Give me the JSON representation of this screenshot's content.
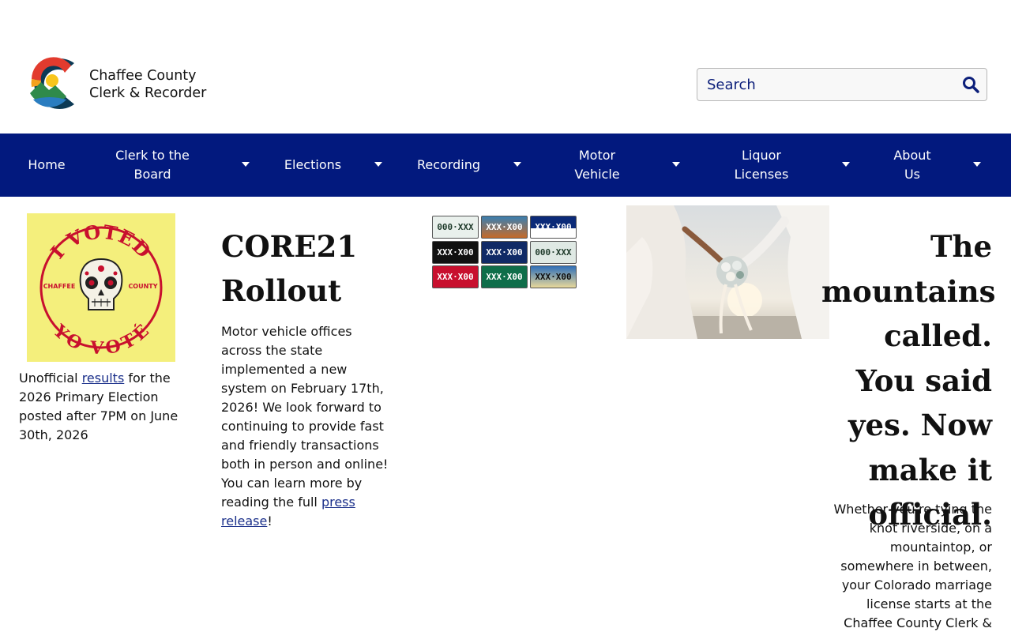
{
  "header": {
    "logo_line1": "Chaffee County",
    "logo_line2": "Clerk & Recorder",
    "logo_icon": "colorado-c-mountain-logo",
    "search_placeholder": "Search",
    "search_icon": "search-icon"
  },
  "nav": {
    "items": [
      {
        "label": "Home",
        "has_dropdown": false
      },
      {
        "label": "Clerk to the Board",
        "has_dropdown": true
      },
      {
        "label": "Elections",
        "has_dropdown": true
      },
      {
        "label": "Recording",
        "has_dropdown": true
      },
      {
        "label": "Motor Vehicle",
        "has_dropdown": true
      },
      {
        "label": "Liquor Licenses",
        "has_dropdown": true
      },
      {
        "label": "About Us",
        "has_dropdown": true
      }
    ]
  },
  "election": {
    "badge_top": "I VOTED",
    "badge_bottom": "YO VOTÉ",
    "badge_left": "CHAFFEE",
    "badge_right": "COUNTY",
    "text_before": "Unofficial ",
    "link": "results",
    "text_after": " for the 2026 Primary Election posted after 7PM on June 30th, 2026"
  },
  "core21": {
    "title": "CORE21 Rollout",
    "body": "Motor vehicle offices across the state implemented a new system on February 17th, 2026! We look forward to continuing to provide fast and friendly transactions both in person and online! You can learn more by reading the full ",
    "link": "press release",
    "end": "!"
  },
  "plates": [
    {
      "text": "000·XXX"
    },
    {
      "text": "XXX·X00"
    },
    {
      "text": "XXX·X00"
    },
    {
      "text": "XXX·X00"
    },
    {
      "text": "XXX·X00"
    },
    {
      "text": "000·XXX"
    },
    {
      "text": "XXX·X00"
    },
    {
      "text": "XXX·X00"
    },
    {
      "text": "XXX·X00"
    }
  ],
  "marriage": {
    "title": "The mountains called. You said yes. Now make it official.",
    "body": "Whether you're tying the knot riverside, on a mountaintop, or somewhere in between, your Colorado marriage license starts at the Chaffee County Clerk &"
  },
  "colors": {
    "nav_bg": "#02197e",
    "link": "#1a2f8a",
    "badge_bg": "#f4ef7c",
    "badge_red": "#c8102e"
  }
}
